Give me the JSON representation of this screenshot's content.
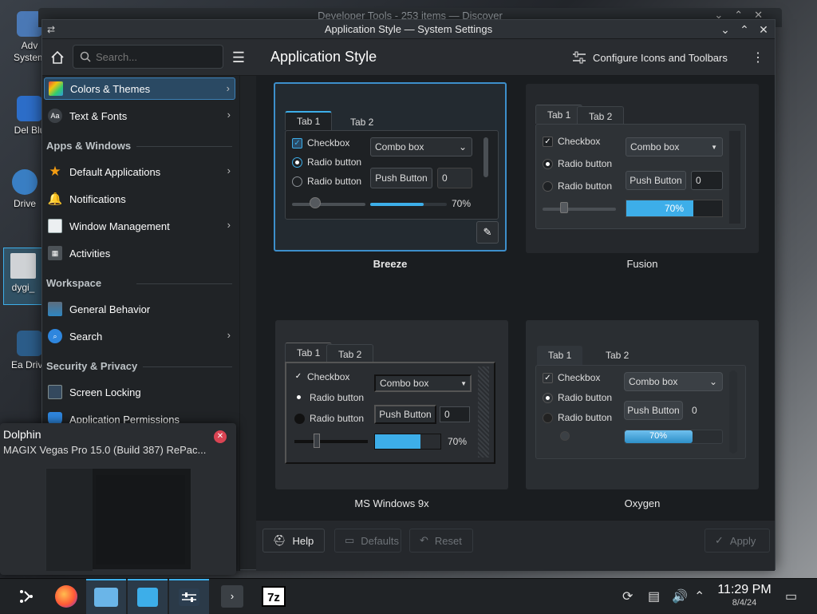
{
  "desktop": {
    "icons": [
      {
        "label": "Adv System",
        "icon": "advanced-system-icon"
      },
      {
        "label": "Del Blu",
        "icon": "app-icon"
      },
      {
        "label": "Drive",
        "icon": "drive-icon"
      },
      {
        "label": "dygi_",
        "icon": "file-icon"
      },
      {
        "label": "Ea Drive",
        "icon": "drive-icon"
      }
    ]
  },
  "background_window": {
    "title": "Developer Tools - 253 items — Discover"
  },
  "window": {
    "title": "Application Style — System Settings",
    "controls": {
      "minimize": "⌄",
      "maximize": "⌃",
      "close": "✕"
    }
  },
  "toolbar": {
    "search_placeholder": "Search...",
    "page_title": "Application Style",
    "configure_label": "Configure Icons and Toolbars"
  },
  "sidebar": {
    "items": [
      {
        "label": "Colors & Themes",
        "icon": "colors-themes-icon",
        "chevron": true,
        "selected": true
      },
      {
        "label": "Text & Fonts",
        "icon": "fonts-icon",
        "chevron": true
      }
    ],
    "apps_windows": {
      "title": "Apps & Windows",
      "items": [
        {
          "label": "Default Applications",
          "icon": "star-icon",
          "chevron": true
        },
        {
          "label": "Notifications",
          "icon": "bell-icon"
        },
        {
          "label": "Window Management",
          "icon": "window-icon",
          "chevron": true
        },
        {
          "label": "Activities",
          "icon": "activities-icon"
        }
      ]
    },
    "workspace": {
      "title": "Workspace",
      "items": [
        {
          "label": "General Behavior",
          "icon": "general-behavior-icon"
        },
        {
          "label": "Search",
          "icon": "search-icon",
          "chevron": true
        }
      ]
    },
    "security": {
      "title": "Security & Privacy",
      "items": [
        {
          "label": "Screen Locking",
          "icon": "screen-lock-icon"
        },
        {
          "label": "Application Permissions",
          "icon": "permissions-icon"
        }
      ]
    }
  },
  "styles": [
    {
      "name": "Breeze",
      "selected": true
    },
    {
      "name": "Fusion"
    },
    {
      "name": "MS Windows 9x"
    },
    {
      "name": "Oxygen"
    }
  ],
  "preview": {
    "tab1": "Tab 1",
    "tab2": "Tab 2",
    "checkbox": "Checkbox",
    "radio": "Radio button",
    "combo": "Combo box",
    "push": "Push Button",
    "spin": "0",
    "progress_label": "70%",
    "progress": 0.7
  },
  "bottom": {
    "help": "Help",
    "defaults": "Defaults",
    "reset": "Reset",
    "apply": "Apply"
  },
  "popup": {
    "app": "Dolphin",
    "subtitle": "MAGIX Vegas Pro 15.0 (Build 387) RePac...",
    "close": "✕"
  },
  "clock": {
    "time": "11:29 PM",
    "date": "8/4/24"
  },
  "colors": {
    "accent": "#3daee9",
    "selection": "#2a4963",
    "close_red": "#da4453"
  }
}
